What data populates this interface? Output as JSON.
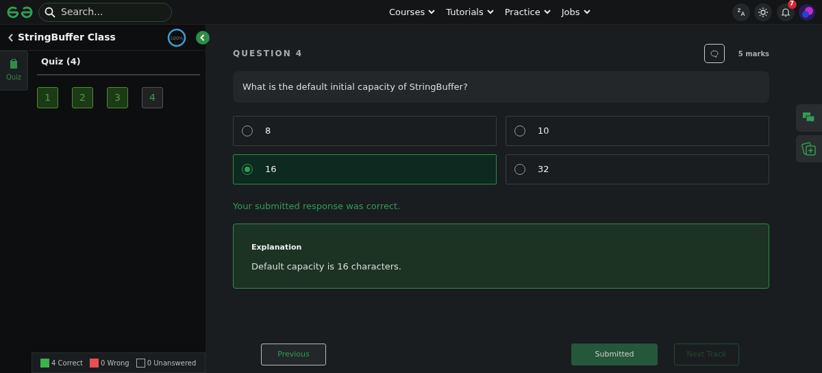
{
  "navbar": {
    "search": {
      "placeholder": "Search..."
    },
    "menus": [
      "Courses",
      "Tutorials",
      "Practice",
      "Jobs"
    ],
    "notification_count": "7"
  },
  "course": {
    "title": "StringBuffer Class",
    "progress_label": "100%",
    "level": 1
  },
  "rail": [
    {
      "label": "Quiz",
      "selected": true
    }
  ],
  "quiz": {
    "title": "Quiz (4)",
    "questions": [
      {
        "label": "1",
        "kind": "correct"
      },
      {
        "label": "2",
        "kind": "correct"
      },
      {
        "label": "3",
        "kind": "correct"
      },
      {
        "label": "4",
        "kind": "current"
      }
    ]
  },
  "legend": [
    {
      "kind": "correct",
      "text": "4 Correct"
    },
    {
      "kind": "wrong",
      "text": "0 Wrong"
    },
    {
      "kind": "unanswered",
      "text": "0 Unanswered"
    }
  ],
  "question": {
    "heading": "QUESTION 4",
    "marks": "5 marks",
    "text": "What is the default initial capacity of StringBuffer?",
    "options": [
      {
        "label": "8",
        "selected": false
      },
      {
        "label": "10",
        "selected": false
      },
      {
        "label": "16",
        "selected": true
      },
      {
        "label": "32",
        "selected": false
      }
    ],
    "feedback": "Your submitted response was correct.",
    "explanation": {
      "title": "Explanation",
      "text": "Default capacity is 16 characters."
    }
  },
  "buttons": [
    {
      "label": "Previous",
      "kind": "outline"
    },
    {
      "label": "Submitted",
      "kind": "submitted"
    },
    {
      "label": "Next Track",
      "kind": "disabled"
    }
  ]
}
